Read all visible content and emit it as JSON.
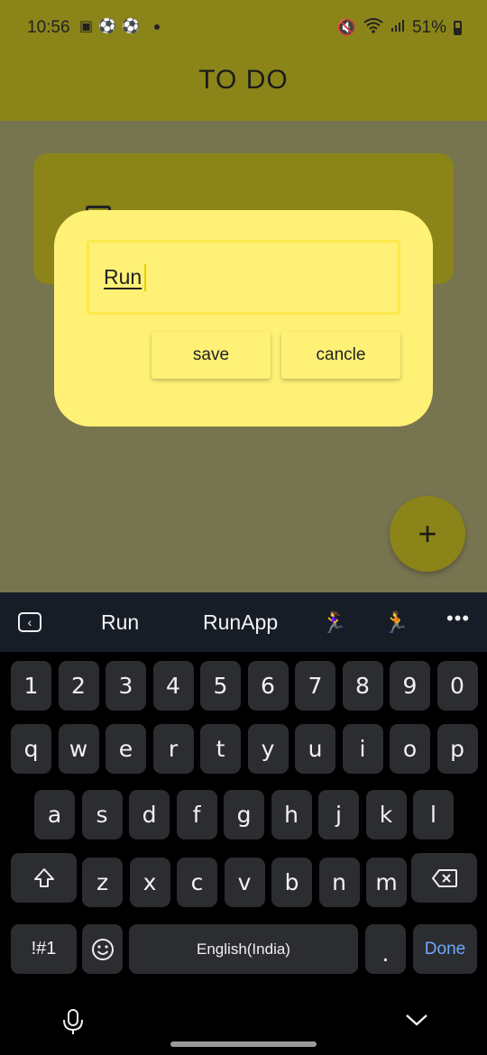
{
  "status_bar": {
    "time": "10:56",
    "battery": "51%"
  },
  "appbar": {
    "title": "TO DO"
  },
  "dialog": {
    "input_value": "Run",
    "save_label": "save",
    "cancel_label": "cancle"
  },
  "fab": {
    "label": "+"
  },
  "keyboard": {
    "suggestions": [
      "Run",
      "RunApp",
      "🏃‍♀️",
      "🏃"
    ],
    "rows": {
      "numbers": [
        "1",
        "2",
        "3",
        "4",
        "5",
        "6",
        "7",
        "8",
        "9",
        "0"
      ],
      "row1": [
        "q",
        "w",
        "e",
        "r",
        "t",
        "y",
        "u",
        "i",
        "o",
        "p"
      ],
      "row2": [
        "a",
        "s",
        "d",
        "f",
        "g",
        "h",
        "j",
        "k",
        "l"
      ],
      "row3": [
        "z",
        "x",
        "c",
        "v",
        "b",
        "n",
        "m"
      ]
    },
    "symbols_label": "!#1",
    "space_label": "English(India)",
    "period_label": ".",
    "done_label": "Done",
    "done_color": "#6ea8ff"
  },
  "colors": {
    "appbar": "#8b8419",
    "dialog": "#fff176",
    "keyboard_key": "#2c2d30"
  }
}
